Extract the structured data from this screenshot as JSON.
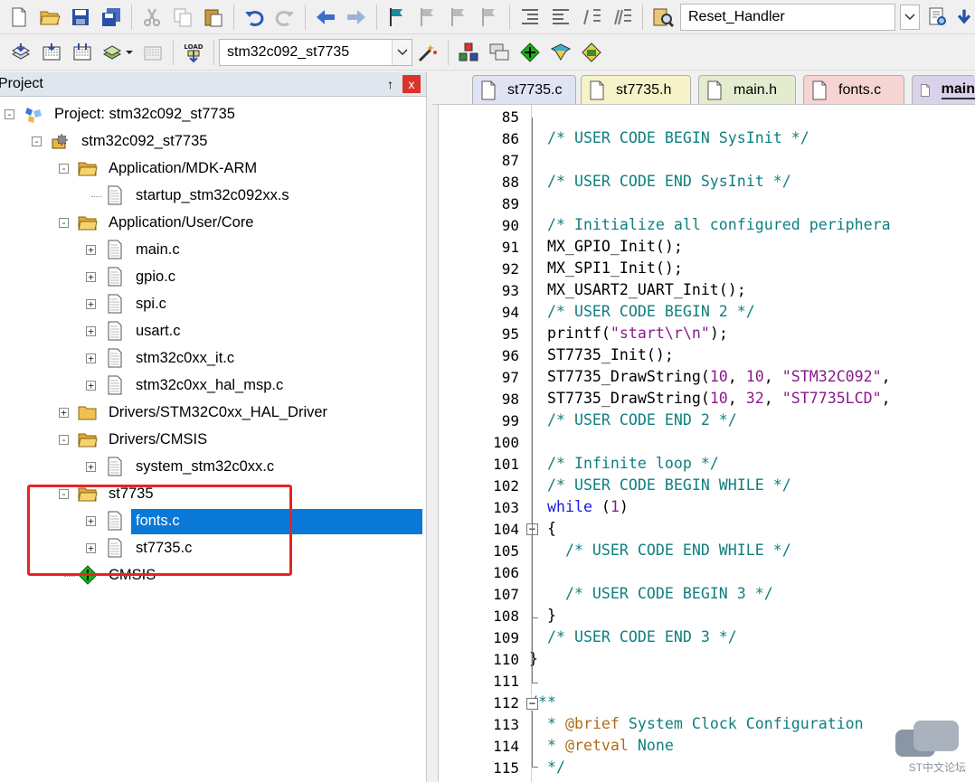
{
  "toolbar1": {
    "target_combo": "Reset_Handler"
  },
  "toolbar2": {
    "target_select": "stm32c092_st7735",
    "load_label": "LOAD"
  },
  "project_panel": {
    "title": "Project",
    "pin": "↑",
    "close": "x",
    "tree": [
      {
        "label": "Project: stm32c092_st7735",
        "depth": 0,
        "expander": "-",
        "icon": "project-icon"
      },
      {
        "label": "stm32c092_st7735",
        "depth": 1,
        "expander": "-",
        "icon": "target-icon"
      },
      {
        "label": "Application/MDK-ARM",
        "depth": 2,
        "expander": "-",
        "icon": "folder-open-icon"
      },
      {
        "label": "startup_stm32c092xx.s",
        "depth": 3,
        "expander": "",
        "icon": "file-icon"
      },
      {
        "label": "Application/User/Core",
        "depth": 2,
        "expander": "-",
        "icon": "folder-open-icon"
      },
      {
        "label": "main.c",
        "depth": 3,
        "expander": "+",
        "icon": "file-icon"
      },
      {
        "label": "gpio.c",
        "depth": 3,
        "expander": "+",
        "icon": "file-icon"
      },
      {
        "label": "spi.c",
        "depth": 3,
        "expander": "+",
        "icon": "file-icon"
      },
      {
        "label": "usart.c",
        "depth": 3,
        "expander": "+",
        "icon": "file-icon"
      },
      {
        "label": "stm32c0xx_it.c",
        "depth": 3,
        "expander": "+",
        "icon": "file-icon"
      },
      {
        "label": "stm32c0xx_hal_msp.c",
        "depth": 3,
        "expander": "+",
        "icon": "file-icon"
      },
      {
        "label": "Drivers/STM32C0xx_HAL_Driver",
        "depth": 2,
        "expander": "+",
        "icon": "folder-icon"
      },
      {
        "label": "Drivers/CMSIS",
        "depth": 2,
        "expander": "-",
        "icon": "folder-open-icon"
      },
      {
        "label": "system_stm32c0xx.c",
        "depth": 3,
        "expander": "+",
        "icon": "file-icon"
      },
      {
        "label": "st7735",
        "depth": 2,
        "expander": "-",
        "icon": "folder-open-icon"
      },
      {
        "label": "fonts.c",
        "depth": 3,
        "expander": "+",
        "icon": "file-icon",
        "selected": true
      },
      {
        "label": "st7735.c",
        "depth": 3,
        "expander": "+",
        "icon": "file-icon"
      },
      {
        "label": "CMSIS",
        "depth": 2,
        "expander": "",
        "icon": "cmsis-diamond-icon"
      }
    ]
  },
  "tabs": [
    {
      "label": "st7735.c",
      "bg": "#dfe3f4"
    },
    {
      "label": "st7735.h",
      "bg": "#f7f3c9"
    },
    {
      "label": "main.h",
      "bg": "#e3eccf"
    },
    {
      "label": "fonts.c",
      "bg": "#f6d4d2"
    },
    {
      "label": "main",
      "bg": "#d9d2ea"
    }
  ],
  "editor": {
    "lines": [
      {
        "n": "85",
        "code": []
      },
      {
        "n": "86",
        "code": [
          [
            "cm",
            "  /* USER CODE BEGIN SysInit */"
          ]
        ]
      },
      {
        "n": "87",
        "code": []
      },
      {
        "n": "88",
        "code": [
          [
            "cm",
            "  /* USER CODE END SysInit */"
          ]
        ]
      },
      {
        "n": "89",
        "code": []
      },
      {
        "n": "90",
        "code": [
          [
            "cm",
            "  /* Initialize all configured periphera"
          ]
        ]
      },
      {
        "n": "91",
        "code": [
          [
            "",
            "  MX_GPIO_Init();"
          ]
        ]
      },
      {
        "n": "92",
        "code": [
          [
            "",
            "  MX_SPI1_Init();"
          ]
        ]
      },
      {
        "n": "93",
        "code": [
          [
            "",
            "  MX_USART2_UART_Init();"
          ]
        ]
      },
      {
        "n": "94",
        "code": [
          [
            "cm",
            "  /* USER CODE BEGIN 2 */"
          ]
        ]
      },
      {
        "n": "95",
        "code": [
          [
            "",
            "  printf("
          ],
          [
            "st",
            "\"start\\r\\n\""
          ],
          [
            "",
            ");"
          ]
        ]
      },
      {
        "n": "96",
        "code": [
          [
            "",
            "  ST7735_Init();"
          ]
        ]
      },
      {
        "n": "97",
        "code": [
          [
            "",
            "  ST7735_DrawString("
          ],
          [
            "nm",
            "10"
          ],
          [
            "",
            ", "
          ],
          [
            "nm",
            "10"
          ],
          [
            "",
            ", "
          ],
          [
            "st",
            "\"STM32C092\""
          ],
          [
            "",
            ","
          ]
        ]
      },
      {
        "n": "98",
        "code": [
          [
            "",
            "  ST7735_DrawString("
          ],
          [
            "nm",
            "10"
          ],
          [
            "",
            ", "
          ],
          [
            "nm",
            "32"
          ],
          [
            "",
            ", "
          ],
          [
            "st",
            "\"ST7735LCD\""
          ],
          [
            "",
            ","
          ]
        ]
      },
      {
        "n": "99",
        "code": [
          [
            "cm",
            "  /* USER CODE END 2 */"
          ]
        ]
      },
      {
        "n": "100",
        "code": []
      },
      {
        "n": "101",
        "code": [
          [
            "cm",
            "  /* Infinite loop */"
          ]
        ]
      },
      {
        "n": "102",
        "code": [
          [
            "cm",
            "  /* USER CODE BEGIN WHILE */"
          ]
        ]
      },
      {
        "n": "103",
        "code": [
          [
            "kw",
            "  while"
          ],
          [
            "",
            " ("
          ],
          [
            "nm",
            "1"
          ],
          [
            "",
            ")"
          ]
        ]
      },
      {
        "n": "104",
        "code": [
          [
            "",
            "  {"
          ]
        ]
      },
      {
        "n": "105",
        "code": [
          [
            "cm",
            "    /* USER CODE END WHILE */"
          ]
        ]
      },
      {
        "n": "106",
        "code": []
      },
      {
        "n": "107",
        "code": [
          [
            "cm",
            "    /* USER CODE BEGIN 3 */"
          ]
        ]
      },
      {
        "n": "108",
        "code": [
          [
            "",
            "  }"
          ]
        ]
      },
      {
        "n": "109",
        "code": [
          [
            "cm",
            "  /* USER CODE END 3 */"
          ]
        ]
      },
      {
        "n": "110",
        "code": [
          [
            "",
            "}"
          ]
        ]
      },
      {
        "n": "111",
        "code": []
      },
      {
        "n": "112",
        "code": [
          [
            "cm",
            "/**"
          ]
        ]
      },
      {
        "n": "113",
        "code": [
          [
            "cm",
            "  * "
          ],
          [
            "at",
            "@brief"
          ],
          [
            "cm",
            " System Clock Configuration"
          ]
        ]
      },
      {
        "n": "114",
        "code": [
          [
            "cm",
            "  * "
          ],
          [
            "at",
            "@retval"
          ],
          [
            "cm",
            " None"
          ]
        ]
      },
      {
        "n": "115",
        "code": [
          [
            "cm",
            "  */"
          ]
        ]
      }
    ]
  },
  "watermark": "ST中文论坛",
  "colors": {
    "selection": "#0a78d7",
    "highlight_box": "#e82424",
    "comment": "#0f7f7f",
    "keyword": "#1a1ad6",
    "string": "#8a1a8a"
  }
}
